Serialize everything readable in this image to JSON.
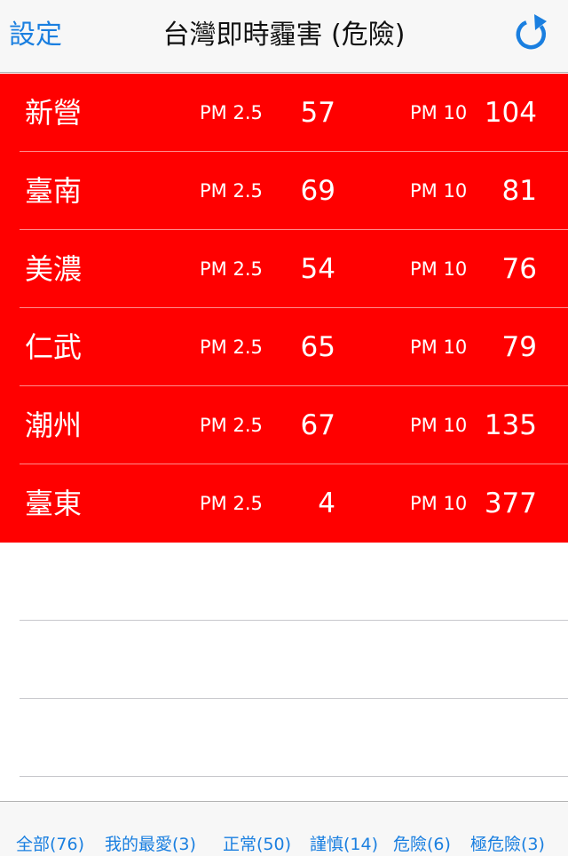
{
  "nav": {
    "left_label": "設定",
    "title": "台灣即時霾害 (危險)",
    "refresh_icon": "refresh-icon"
  },
  "colors": {
    "accent": "#1a7fe0",
    "danger_row": "#ff0000"
  },
  "stations": [
    {
      "name": "新營",
      "pm25_label": "PM 2.5",
      "pm25": "57",
      "pm10_label": "PM 10",
      "pm10": "104"
    },
    {
      "name": "臺南",
      "pm25_label": "PM 2.5",
      "pm25": "69",
      "pm10_label": "PM 10",
      "pm10": "81"
    },
    {
      "name": "美濃",
      "pm25_label": "PM 2.5",
      "pm25": "54",
      "pm10_label": "PM 10",
      "pm10": "76"
    },
    {
      "name": "仁武",
      "pm25_label": "PM 2.5",
      "pm25": "65",
      "pm10_label": "PM 10",
      "pm10": "79"
    },
    {
      "name": "潮州",
      "pm25_label": "PM 2.5",
      "pm25": "67",
      "pm10_label": "PM 10",
      "pm10": "135"
    },
    {
      "name": "臺東",
      "pm25_label": "PM 2.5",
      "pm25": "4",
      "pm10_label": "PM 10",
      "pm10": "377"
    }
  ],
  "tabs": [
    {
      "label": "全部(76)"
    },
    {
      "label": "我的最愛(3)"
    },
    {
      "label": "正常(50)"
    },
    {
      "label": "謹慎(14)"
    },
    {
      "label": "危險(6)"
    },
    {
      "label": "極危險(3)"
    }
  ]
}
